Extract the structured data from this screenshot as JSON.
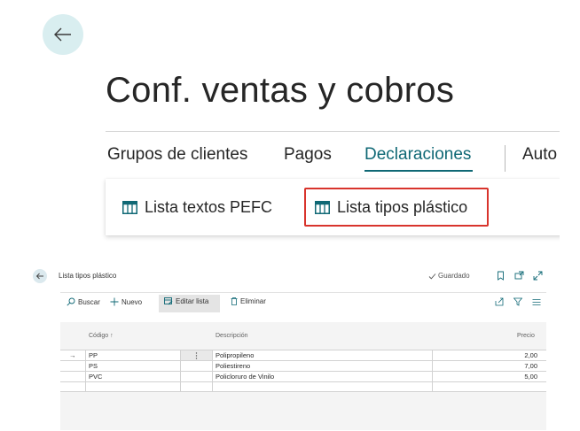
{
  "page": {
    "title": "Conf. ventas y cobros",
    "nav": [
      {
        "label": "Grupos de clientes"
      },
      {
        "label": "Pagos"
      },
      {
        "label": "Declaraciones"
      },
      {
        "label": "Auto"
      }
    ],
    "actions": [
      {
        "label": "Lista textos PEFC"
      },
      {
        "label": "Lista tipos plástico"
      }
    ]
  },
  "list_page": {
    "title": "Lista tipos plástico",
    "saved_label": "Guardado",
    "toolbar": {
      "search": "Buscar",
      "new": "Nuevo",
      "edit_list": "Editar lista",
      "delete": "Eliminar"
    },
    "columns": {
      "code": "Código ↑",
      "description": "Descripción",
      "price": "Precio"
    },
    "rows": [
      {
        "code": "PP",
        "description": "Polipropileno",
        "price": "2,00",
        "marker": "→"
      },
      {
        "code": "PS",
        "description": "Poliestireno",
        "price": "7,00"
      },
      {
        "code": "PVC",
        "description": "Policloruro de Vinilo",
        "price": "5,00"
      }
    ]
  },
  "colors": {
    "accent": "#0f6875",
    "highlight": "#d8342c"
  },
  "icons": [
    "arrow-left-icon",
    "table-icon",
    "checkmark-icon",
    "bookmark-icon",
    "open-new-window-icon",
    "expand-icon",
    "search-icon",
    "plus-icon",
    "edit-list-icon",
    "trash-icon",
    "share-icon",
    "filter-icon",
    "list-menu-icon",
    "more-options-icon"
  ]
}
